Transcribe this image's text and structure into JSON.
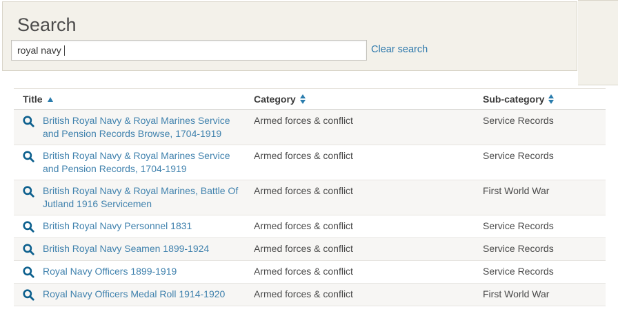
{
  "search": {
    "heading": "Search",
    "query": "royal navy",
    "clear_label": "Clear search"
  },
  "table": {
    "columns": [
      {
        "label": "Title",
        "sort_state": "ascending"
      },
      {
        "label": "Category",
        "sort_state": "sortable"
      },
      {
        "label": "Sub-category",
        "sort_state": "sortable"
      }
    ],
    "rows": [
      {
        "title": "British Royal Navy & Royal Marines Service and Pension Records Browse, 1704-1919",
        "category": "Armed forces & conflict",
        "subcategory": "Service Records"
      },
      {
        "title": "British Royal Navy & Royal Marines Service and Pension Records, 1704-1919",
        "category": "Armed forces & conflict",
        "subcategory": "Service Records"
      },
      {
        "title": "British Royal Navy & Royal Marines, Battle Of Jutland 1916 Servicemen",
        "category": "Armed forces & conflict",
        "subcategory": "First World War"
      },
      {
        "title": "British Royal Navy Personnel 1831",
        "category": "Armed forces & conflict",
        "subcategory": "Service Records"
      },
      {
        "title": "British Royal Navy Seamen 1899-1924",
        "category": "Armed forces & conflict",
        "subcategory": "Service Records"
      },
      {
        "title": "Royal Navy Officers 1899-1919",
        "category": "Armed forces & conflict",
        "subcategory": "Service Records"
      },
      {
        "title": "Royal Navy Officers Medal Roll 1914-1920",
        "category": "Armed forces & conflict",
        "subcategory": "First World War"
      }
    ]
  },
  "icons": {
    "row_icon": "magnifier-icon",
    "title_sort_icon": "sort-ascending-icon",
    "column_sort_icon": "sort-toggle-icon"
  },
  "colors": {
    "panel_bg": "#f3f1ea",
    "panel_border": "#d9d5c9",
    "link": "#3f81ad",
    "clear_link": "#2b77ab",
    "icon": "#0d608e",
    "sort_arrow": "#2a7cad",
    "stripe": "#f7f6f4",
    "header_text": "#3b3b3b",
    "body_text": "#4a4a4a"
  }
}
